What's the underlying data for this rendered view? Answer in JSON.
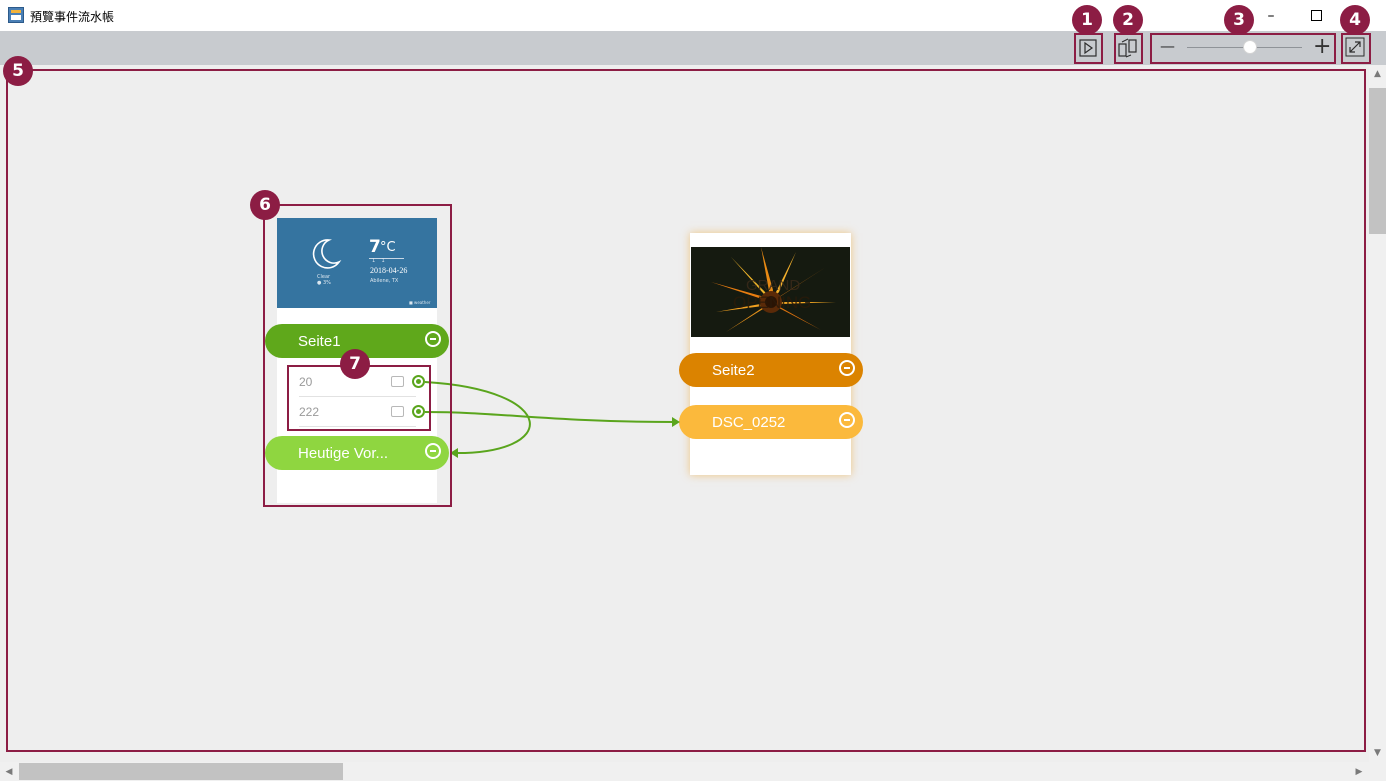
{
  "window": {
    "title": "預覽事件流水帳",
    "minimize_glyph": "–",
    "maximize_glyph": "☐",
    "close_glyph": "✕"
  },
  "toolbar": {
    "play_icon": "play-icon",
    "swap_icon": "swap-icon",
    "zoom_out_glyph": "—",
    "zoom_in_glyph": "+",
    "zoom_level": 0.55,
    "fullscreen_icon": "expand-icon"
  },
  "annotations": [
    "1",
    "2",
    "3",
    "4",
    "5",
    "6",
    "7"
  ],
  "card1": {
    "weather": {
      "temp": "7",
      "unit": "°C",
      "range": "1    1",
      "date": "2018-04-26",
      "location": "Abilene, TX",
      "cond": "Clear",
      "sub": "● 3%",
      "brand": "■ weather"
    },
    "page_label": "Seite1",
    "rows": [
      {
        "label": "20"
      },
      {
        "label": "222"
      }
    ],
    "target_label": "Heutige Vor..."
  },
  "card2": {
    "image_text_line1": "GRAND",
    "image_text_line2": "OPENING",
    "page_label": "Seite2",
    "item_label": "DSC_0252"
  },
  "colors": {
    "annotation": "#8c1d44",
    "seite1": "#5fa81b",
    "heutige": "#8fd640",
    "seite2": "#db8300",
    "dsc": "#fbb93c",
    "weather_bg": "#3574a0",
    "link": "#5aa51d"
  }
}
